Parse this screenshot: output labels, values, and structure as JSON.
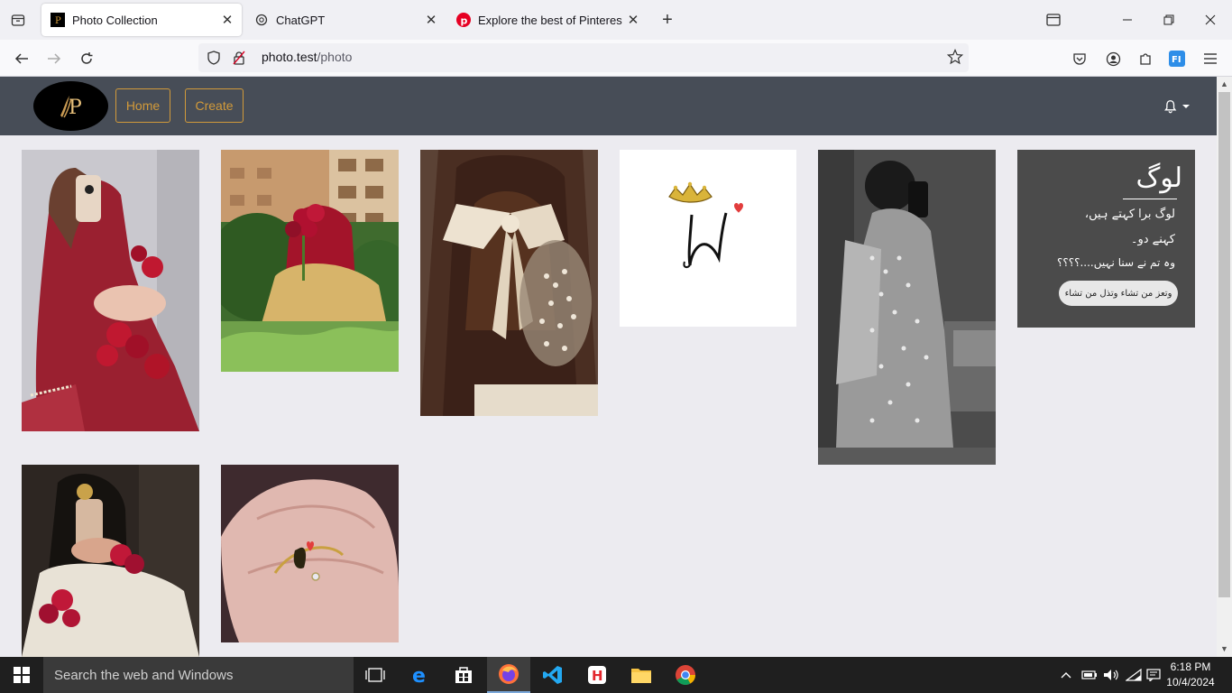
{
  "browser": {
    "tabs": [
      {
        "title": "Photo Collection",
        "active": true
      },
      {
        "title": "ChatGPT",
        "active": false
      },
      {
        "title": "Explore the best of Pinterest",
        "active": false
      }
    ],
    "url": {
      "host": "photo.test",
      "path": "/photo"
    }
  },
  "app": {
    "logo_letter": "P",
    "nav": {
      "home_label": "Home",
      "create_label": "Create"
    },
    "notification_icon": "bell-icon"
  },
  "photos": [
    {
      "label": "girl-with-red-roses-mirror-selfie"
    },
    {
      "label": "girl-with-red-dupatta-and-roses"
    },
    {
      "label": "hair-with-white-bow"
    },
    {
      "label": "letter-n-with-crown"
    },
    {
      "label": "black-and-white-mirror-selfie"
    },
    {
      "label": "urdu-poetry-card",
      "lines": [
        "لوگ",
        "لوگ برا کہتے ہیں،",
        "کہنے دو۔",
        "وہ تم نے سنا نہیں....؟؟؟؟",
        "وتعز من تشاء وتذل من تشاء"
      ]
    },
    {
      "label": "girl-with-phone-and-bangles"
    },
    {
      "label": "ring-with-letter-n"
    }
  ],
  "taskbar": {
    "search_placeholder": "Search the web and Windows",
    "time": "6:18 PM",
    "date": "10/4/2024"
  },
  "colors": {
    "accent": "#d29a3a",
    "navbar": "#474d57"
  }
}
